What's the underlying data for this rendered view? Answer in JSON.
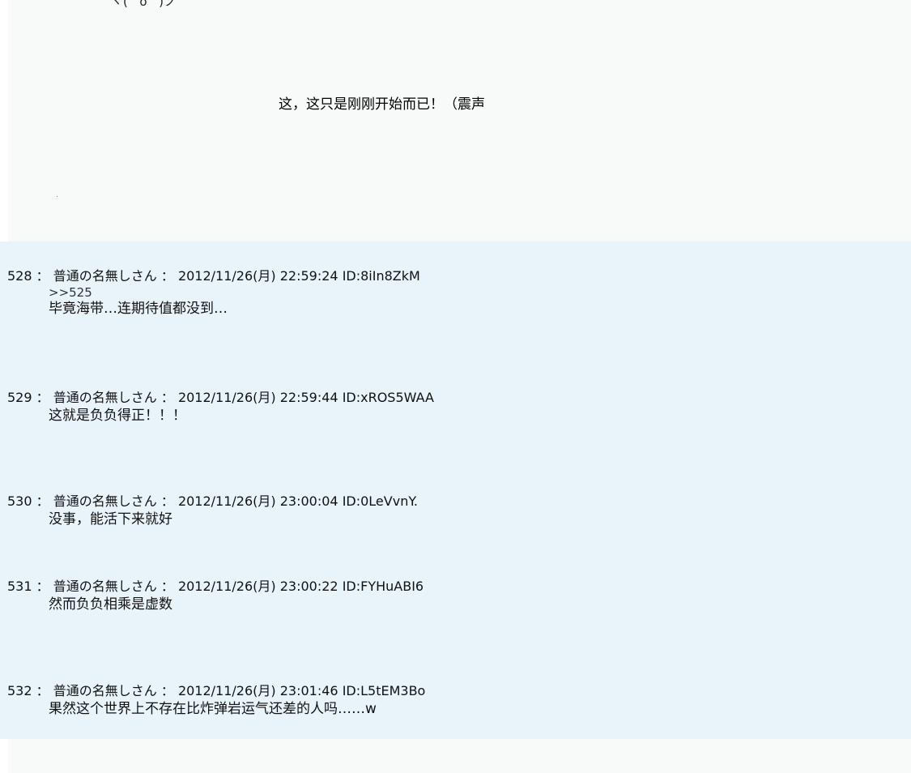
{
  "story": {
    "cut_text": "ヽ(^o^)ノ",
    "main_line": "这，这只是刚刚开始而已！（震声"
  },
  "posts": [
    {
      "number": "528",
      "name": "普通の名無しさん",
      "datetime": "2012/11/26(月) 22:59:24",
      "id": "ID:8iIn8ZkM",
      "reply": ">>525",
      "body": "毕竟海带…连期待值都没到…"
    },
    {
      "number": "529",
      "name": "普通の名無しさん",
      "datetime": "2012/11/26(月) 22:59:44",
      "id": "ID:xROS5WAA",
      "body": "这就是负负得正！！！"
    },
    {
      "number": "530",
      "name": "普通の名無しさん",
      "datetime": "2012/11/26(月) 23:00:04",
      "id": "ID:0LeVvnY.",
      "body": "没事，能活下来就好"
    },
    {
      "number": "531",
      "name": "普通の名無しさん",
      "datetime": "2012/11/26(月) 23:00:22",
      "id": "ID:FYHuABI6",
      "body": "然而负负相乘是虚数"
    },
    {
      "number": "532",
      "name": "普通の名無しさん",
      "datetime": "2012/11/26(月) 23:01:46",
      "id": "ID:L5tEM3Bo",
      "body": "果然这个世界上不存在比炸弹岩运气还差的人吗……w"
    }
  ]
}
